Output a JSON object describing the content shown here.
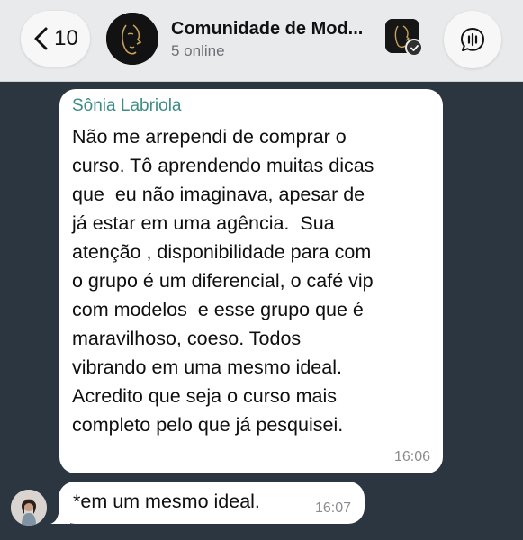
{
  "header": {
    "back_count": "10",
    "group_name": "Comunidade de Mod...",
    "online_status": "5 online"
  },
  "messages": [
    {
      "sender": "Sônia Labriola",
      "text": "Não me arrependi de comprar o\ncurso. Tô aprendendo muitas dicas\nque  eu não imaginava, apesar de\njá estar em uma agência.  Sua\natenção , disponibilidade para com\no grupo é um diferencial, o café vip\ncom modelos  e esse grupo que é\nmaravilhoso, coeso. Todos\nvibrando em uma mesmo ideal.\nAcredito que seja o curso mais\ncompleto pelo que já pesquisei.",
      "time": "16:06"
    },
    {
      "text": "*em um mesmo ideal.",
      "time": "16:07"
    }
  ],
  "colors": {
    "chat_background": "#2b3640",
    "header_background": "#e9eaec",
    "bubble": "#ffffff",
    "sender_name": "#3e8c85",
    "timestamp": "#8a8c8f"
  },
  "icons": {
    "back": "chevron-left-icon",
    "call": "audio-call-icon",
    "community": "community-icon"
  }
}
